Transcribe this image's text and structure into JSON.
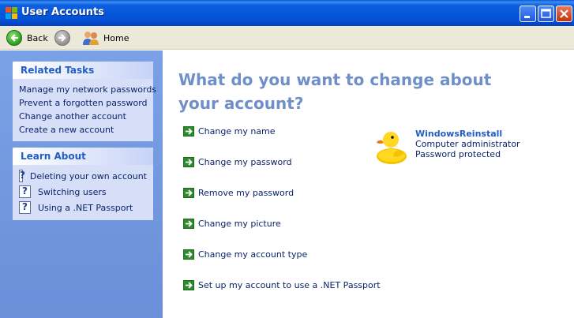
{
  "window": {
    "title": "User Accounts",
    "controls": {
      "minimize": "minimize-icon",
      "maximize": "maximize-icon",
      "close": "close-icon"
    }
  },
  "toolbar": {
    "back_label": "Back",
    "home_label": "Home"
  },
  "related_tasks": {
    "title": "Related Tasks",
    "items": [
      "Manage my network passwords",
      "Prevent a forgotten password",
      "Change another account",
      "Create a new account"
    ]
  },
  "learn_about": {
    "title": "Learn About",
    "items": [
      "Deleting your own account",
      "Switching users",
      "Using a .NET Passport"
    ]
  },
  "main": {
    "heading": "What do you want to change about your account?",
    "options": [
      "Change my name",
      "Change my password",
      "Remove my password",
      "Change my picture",
      "Change my account type",
      "Set up my account to use a .NET Passport"
    ]
  },
  "user": {
    "name": "WindowsReinstall",
    "type": "Computer administrator",
    "password_status": "Password protected",
    "picture_icon": "rubber-duck-icon"
  },
  "colors": {
    "titlebar": "#0452d6",
    "left_pane": "#7aa1e6",
    "heading": "#6f8fc9",
    "link": "#0a246a",
    "box_title": "#215dc6"
  }
}
